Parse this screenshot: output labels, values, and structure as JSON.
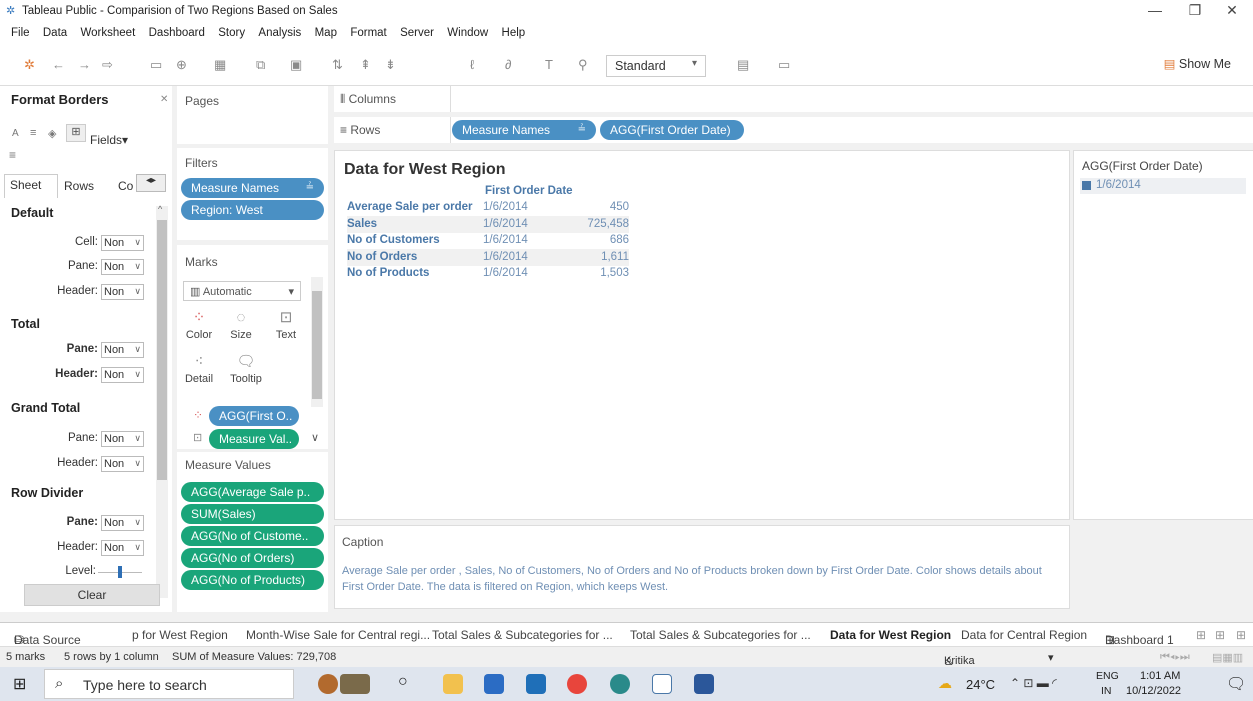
{
  "window": {
    "title": "Tableau Public - Comparision of Two Regions Based on Sales"
  },
  "menu": [
    "File",
    "Data",
    "Worksheet",
    "Dashboard",
    "Story",
    "Analysis",
    "Map",
    "Format",
    "Server",
    "Window",
    "Help"
  ],
  "toolbar": {
    "fit": "Standard",
    "show_me": "Show Me"
  },
  "format_panel": {
    "title": "Format Borders",
    "fields": "Fields",
    "tabs": [
      "Sheet",
      "Rows",
      "Co"
    ],
    "sections": [
      {
        "title": "Default",
        "rows": [
          {
            "label": "Cell:",
            "value": "Non"
          },
          {
            "label": "Pane:",
            "value": "Non"
          },
          {
            "label": "Header:",
            "value": "Non"
          }
        ]
      },
      {
        "title": "Total",
        "rows": [
          {
            "label": "Pane:",
            "value": "Non"
          },
          {
            "label": "Header:",
            "value": "Non"
          }
        ]
      },
      {
        "title": "Grand Total",
        "rows": [
          {
            "label": "Pane:",
            "value": "Non"
          },
          {
            "label": "Header:",
            "value": "Non"
          }
        ]
      },
      {
        "title": "Row Divider",
        "rows": [
          {
            "label": "Pane:",
            "value": "Non"
          },
          {
            "label": "Header:",
            "value": "Non"
          },
          {
            "label": "Level:",
            "value": ""
          }
        ]
      }
    ],
    "clear": "Clear"
  },
  "pages": {
    "title": "Pages"
  },
  "filters": {
    "title": "Filters",
    "pills": [
      "Measure Names",
      "Region: West"
    ]
  },
  "marks": {
    "title": "Marks",
    "type": "Automatic",
    "buttons": [
      "Color",
      "Size",
      "Text",
      "Detail",
      "Tooltip"
    ],
    "pills": [
      "AGG(First O..",
      "Measure Val.."
    ]
  },
  "measure_values": {
    "title": "Measure Values",
    "pills": [
      "AGG(Average Sale p..",
      "SUM(Sales)",
      "AGG(No of Custome..",
      "AGG(No of Orders)",
      "AGG(No of Products)"
    ]
  },
  "shelves": {
    "columns": "Columns",
    "rows": "Rows",
    "row_pills": [
      "Measure Names",
      "AGG(First Order Date)"
    ]
  },
  "view": {
    "title": "Data for West Region",
    "column_header": "First Order Date",
    "rows": [
      {
        "name": "Average Sale per order",
        "date": "1/6/2014",
        "value": "450"
      },
      {
        "name": "Sales",
        "date": "1/6/2014",
        "value": "725,458"
      },
      {
        "name": "No of Customers",
        "date": "1/6/2014",
        "value": "686"
      },
      {
        "name": "No of Orders",
        "date": "1/6/2014",
        "value": "1,611"
      },
      {
        "name": "No of Products",
        "date": "1/6/2014",
        "value": "1,503"
      }
    ]
  },
  "legend": {
    "title": "AGG(First Order Date)",
    "item": "1/6/2014",
    "color": "#4a78a8"
  },
  "caption": {
    "title": "Caption",
    "text": "Average Sale per order , Sales, No of Customers, No of Orders and No of Products broken down by First Order Date.  Color shows details about First Order Date. The data is filtered on Region, which keeps West."
  },
  "sheet_tabs": [
    "Data Source",
    "p for West Region",
    "Month-Wise Sale for Central regi...",
    "Total Sales & Subcategories for ...",
    "Total Sales & Subcategories for ...",
    "Data for West Region",
    "Data for Central Region",
    "Dashboard 1"
  ],
  "status": {
    "marks": "5 marks",
    "rows": "5 rows by 1 column",
    "sum": "SUM of Measure Values: 729,708",
    "user": "Kritika setia"
  },
  "taskbar": {
    "search": "Type here to search",
    "weather": "24°C",
    "lang": "ENG",
    "region": "IN",
    "time": "1:01 AM",
    "date": "10/12/2022"
  }
}
